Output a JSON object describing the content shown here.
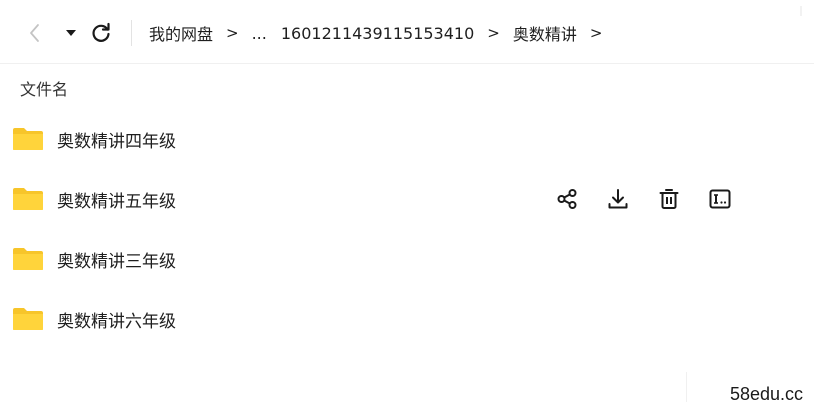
{
  "breadcrumb": {
    "root": "我的网盘",
    "ellipsis": "...",
    "folder_id": "1601211439115153410",
    "current": "奥数精讲",
    "separator": ">"
  },
  "list": {
    "column_header": "文件名",
    "rows": [
      {
        "name": "奥数精讲四年级",
        "icon": "folder-icon"
      },
      {
        "name": "奥数精讲五年级",
        "icon": "folder-icon"
      },
      {
        "name": "奥数精讲三年级",
        "icon": "folder-icon"
      },
      {
        "name": "奥数精讲六年级",
        "icon": "folder-icon"
      }
    ]
  },
  "row_actions": {
    "icons": [
      "share-icon",
      "download-icon",
      "delete-icon",
      "rename-icon"
    ]
  },
  "watermark": "58edu.cc",
  "colors": {
    "folder": "#FFD43B",
    "folder_tab": "#F7C52A",
    "icon": "#1a1a1a"
  }
}
